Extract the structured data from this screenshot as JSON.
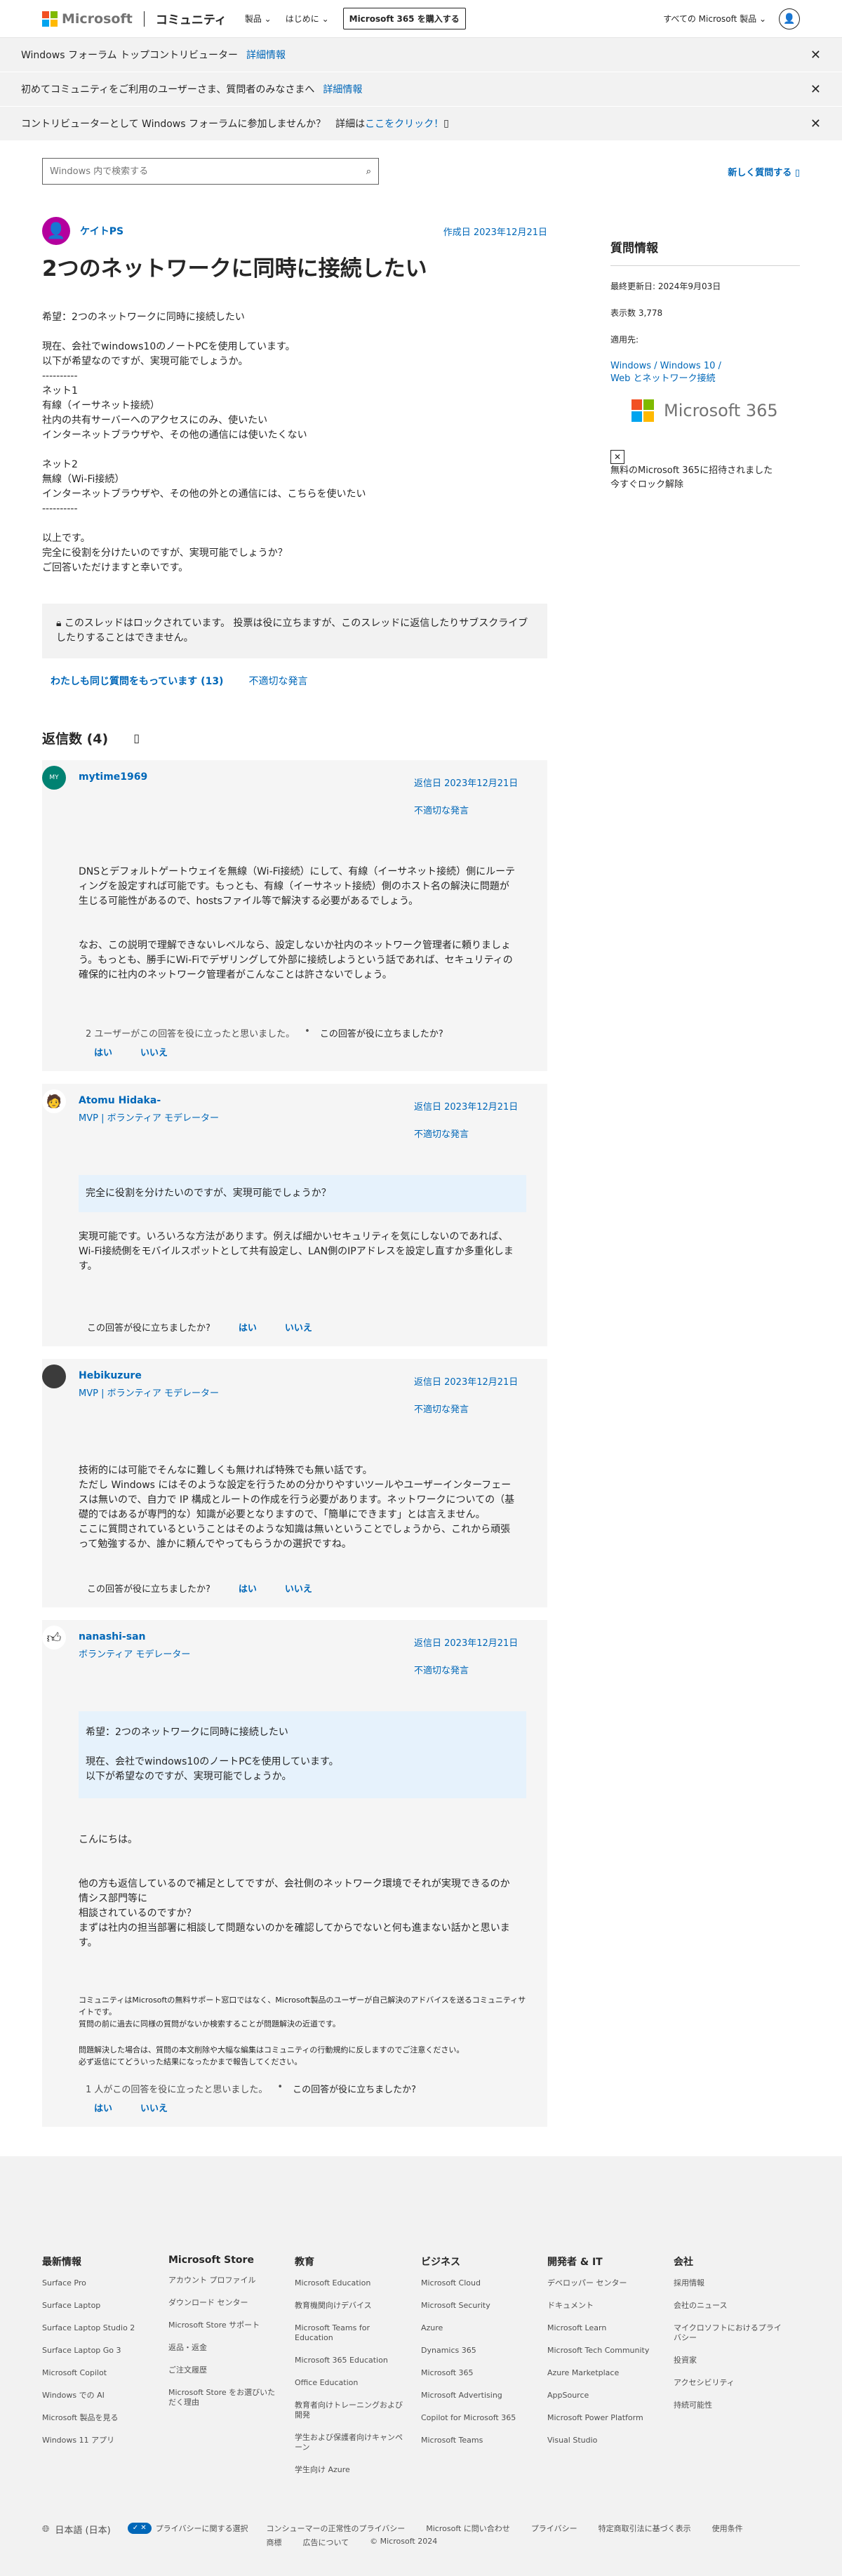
{
  "header": {
    "brand": "Microsoft",
    "site": "コミュニティ",
    "nav": [
      "製品",
      "はじめに"
    ],
    "buy": "Microsoft 365 を購入する",
    "all_products": "すべての Microsoft 製品"
  },
  "banners": [
    {
      "text": "Windows フォーラム トップコントリビューター",
      "link": "詳細情報"
    },
    {
      "text": "初めてコミュニティをご利用のユーザーさま、質問者のみなさまへ",
      "link": "詳細情報"
    },
    {
      "text": "コントリビューターとして Windows フォーラムに参加しませんか？　詳細は",
      "link": "ここをクリック！"
    }
  ],
  "search": {
    "placeholder": "Windows 内で検索する",
    "new_question": "新しく質問する"
  },
  "question": {
    "author": "ケイトPS",
    "date": "作成日 2023年12月21日",
    "title": "2つのネットワークに同時に接続したい",
    "body": "希望：2つのネットワークに同時に接続したい\n\n現在、会社でwindows10のノートPCを使用しています。\n以下が希望なのですが、実現可能でしょうか。\n----------\nネット1\n有線（イーサネット接続）\n社内の共有サーバーへのアクセスにのみ、使いたい\nインターネットブラウザや、その他の通信には使いたくない\n\nネット2\n無線（Wi-Fi接続）\nインターネットブラウザや、その他の外との通信には、こちらを使いたい\n----------\n\n以上です。\n完全に役割を分けたいのですが、実現可能でしょうか？\nご回答いただけますと幸いです。",
    "locked": "このスレッドはロックされています。 投票は役に立ちますが、このスレッドに返信したりサブスクライブしたりすることはできません。",
    "same_question": "わたしも同じ質問をもっています (13)",
    "report": "不適切な発言"
  },
  "replies_title": "返信数 (4)",
  "replies": [
    {
      "initials": "MY",
      "name": "mytime1969",
      "role": "",
      "date": "返信日 2023年12月21日",
      "report": "不適切な発言",
      "quote": "",
      "body1": "DNSとデフォルトゲートウェイを無線（Wi-Fi接続）にして、有線（イーサネット接続）側にルーティングを設定すれば可能です。もっとも、有線（イーサネット接続）側のホスト名の解決に問題が生じる可能性があるので、hostsファイル等で解決する必要があるでしょう。",
      "body2": "なお、この説明で理解できないレベルなら、設定しないか社内のネットワーク管理者に頼りましょう。もっとも、勝手にWi-Fiでデザリングして外部に接続しようという話であれば、セキュリティの確保的に社内のネットワーク管理者がこんなことは許さないでしょう。",
      "votes": "2 ユーザーがこの回答を役に立ったと思いました。",
      "helpful": "この回答が役に立ちましたか?",
      "yes": "はい",
      "no": "いいえ"
    },
    {
      "name": "Atomu Hidaka-",
      "role": "MVP | ボランティア モデレーター",
      "date": "返信日 2023年12月21日",
      "report": "不適切な発言",
      "quote": "完全に役割を分けたいのですが、実現可能でしょうか？",
      "body1": "実現可能です。いろいろな方法があります。例えば細かいセキュリティを気にしないのであれば、Wi-Fi接続側をモバイルスポットとして共有設定し、LAN側のIPアドレスを設定し直すか多重化します。",
      "helpful": "この回答が役に立ちましたか?",
      "yes": "はい",
      "no": "いいえ"
    },
    {
      "name": "Hebikuzure",
      "role": "MVP | ボランティア モデレーター",
      "date": "返信日 2023年12月21日",
      "report": "不適切な発言",
      "body1": "技術的には可能でそんなに難しくも無ければ特殊でも無い話です。\nただし Windows にはそのような設定を行うための分かりやすいツールやユーザーインターフェースは無いので、自力で IP 構成とルートの作成を行う必要があります。ネットワークについての（基礎的ではあるが専門的な）知識が必要となりますので、「簡単にできます」とは言えません。\nここに質問されているということはそのような知識は無いということでしょうから、これから頑張って勉強するか、誰かに頼んでやってもらうかの選択ですね。",
      "helpful": "この回答が役に立ちましたか?",
      "yes": "はい",
      "no": "いいえ"
    },
    {
      "name": "nanashi-san",
      "role": "ボランティア モデレーター",
      "date": "返信日 2023年12月21日",
      "report": "不適切な発言",
      "quote": "希望：2つのネットワークに同時に接続したい\n\n現在、会社でwindows10のノートPCを使用しています。\n以下が希望なのですが、実現可能でしょうか。",
      "body1": "こんにちは。",
      "body2": "他の方も返信しているので補足としてですが、会社側のネットワーク環境でそれが実現できるのか情シス部門等に\n相談されているのですか？\nまずは社内の担当部署に相談して問題ないのかを確認してからでないと何も進まない話かと思います。",
      "small1": "コミュニティはMicrosoftの無料サポート窓口ではなく、Microsoft製品のユーザーが自己解決のアドバイスを送るコミュニティサイトです。\n質問の前に過去に同様の質問がないか検索することが問題解決の近道です。",
      "small2": "問題解決した場合は、質問の本文削除や大幅な編集はコミュニティの行動規約に反しますのでご注意ください。\n必ず返信にてどういった結果になったかまで報告してください。",
      "votes": "1 人がこの回答を役に立ったと思いました。",
      "helpful": "この回答が役に立ちましたか?",
      "yes": "はい",
      "no": "いいえ"
    }
  ],
  "sidebar": {
    "title": "質問情報",
    "updated": "最終更新日: 2024年9月03日",
    "views": "表示数 3,778",
    "applies": "適用先:",
    "applies_links": "Windows / Windows 10 /\nWeb とネットワーク接続",
    "brand": "Microsoft 365",
    "invite1": "無料のMicrosoft 365に招待されました",
    "invite2": "今すぐロック解除"
  },
  "footer": {
    "columns": [
      {
        "title": "最新情報",
        "items": [
          "Surface Pro",
          "Surface Laptop",
          "Surface Laptop Studio 2",
          "Surface Laptop Go 3",
          "Microsoft Copilot",
          "Windows での AI",
          "Microsoft 製品を見る",
          "Windows 11 アプリ"
        ]
      },
      {
        "title": "Microsoft Store",
        "items": [
          "アカウント プロファイル",
          "ダウンロード センター",
          "Microsoft Store サポート",
          "返品・返金",
          "ご注文履歴",
          "Microsoft Store をお選びいただく理由"
        ]
      },
      {
        "title": "教育",
        "items": [
          "Microsoft Education",
          "教育機関向けデバイス",
          "Microsoft Teams for Education",
          "Microsoft 365 Education",
          "Office Education",
          "教育者向けトレーニングおよび開発",
          "学生および保護者向けキャンペーン",
          "学生向け Azure"
        ]
      },
      {
        "title": "ビジネス",
        "items": [
          "Microsoft Cloud",
          "Microsoft Security",
          "Azure",
          "Dynamics 365",
          "Microsoft 365",
          "Microsoft Advertising",
          "Copilot for Microsoft 365",
          "Microsoft Teams"
        ]
      },
      {
        "title": "開発者 & IT",
        "items": [
          "デベロッパー センター",
          "ドキュメント",
          "Microsoft Learn",
          "Microsoft Tech Community",
          "Azure Marketplace",
          "AppSource",
          "Microsoft Power Platform",
          "Visual Studio"
        ]
      },
      {
        "title": "会社",
        "items": [
          "採用情報",
          "会社のニュース",
          "マイクロソフトにおけるプライバシー",
          "投資家",
          "アクセシビリティ",
          "持続可能性"
        ]
      }
    ],
    "language": "日本語 (日本)",
    "privacy_choice": "プライバシーに関する選択",
    "links": [
      "コンシューマーの正常性のプライバシー",
      "Microsoft に問い合わせ",
      "プライバシー",
      "特定商取引法に基づく表示",
      "使用条件",
      "商標",
      "広告について",
      "© Microsoft 2024"
    ]
  },
  "colors": {
    "accent": "#0067b8",
    "red": "#f25022",
    "green": "#7fba00",
    "blue": "#00a4ef",
    "yellow": "#ffb900"
  }
}
